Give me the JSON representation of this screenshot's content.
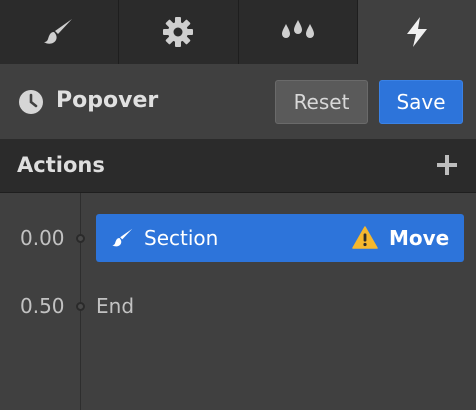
{
  "tabs": [
    {
      "icon": "brush-icon",
      "active": false
    },
    {
      "icon": "gear-icon",
      "active": false
    },
    {
      "icon": "drops-icon",
      "active": false
    },
    {
      "icon": "lightning-icon",
      "active": true
    }
  ],
  "header": {
    "icon": "clock-icon",
    "title": "Popover",
    "reset_label": "Reset",
    "save_label": "Save"
  },
  "actions_section": {
    "title": "Actions",
    "add_icon": "plus-icon"
  },
  "timeline": {
    "items": [
      {
        "time": "0.00",
        "icon": "brush-icon",
        "label": "Section",
        "warning_icon": "warning-icon",
        "type": "Move"
      },
      {
        "time": "0.50",
        "label": "End"
      }
    ]
  },
  "colors": {
    "accent": "#2d74da",
    "background": "#404040",
    "panel_dark": "#2b2b2b",
    "warning": "#f5b82e"
  }
}
